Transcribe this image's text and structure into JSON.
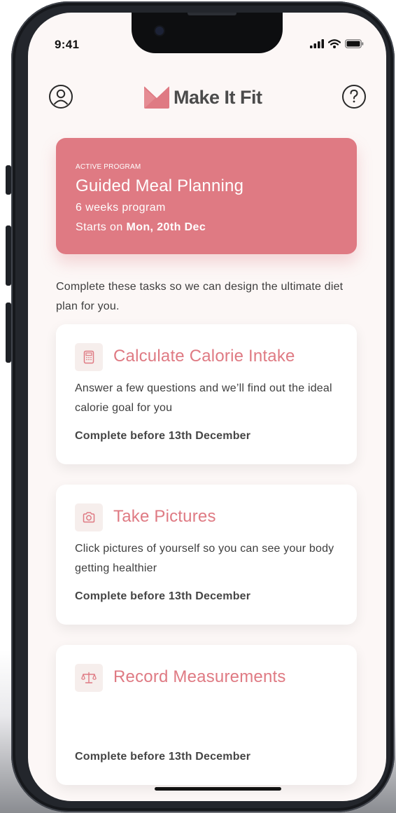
{
  "status_bar": {
    "time": "9:41",
    "icons": [
      "cellular-signal-icon",
      "wifi-icon",
      "battery-icon"
    ]
  },
  "header": {
    "left_icon": "user-profile-icon",
    "app_name": "Make It Fit",
    "logo_icon": "make-it-fit-logo-icon",
    "right_icon": "help-question-icon"
  },
  "active_program": {
    "kicker": "ACTIVE PROGRAM",
    "title": "Guided Meal Planning",
    "duration": "6 weeks program",
    "start_prefix": "Starts on ",
    "start_date": "Mon, 20th Dec"
  },
  "intro_text": "Complete these tasks so we can design the ultimate diet plan for you.",
  "tasks": [
    {
      "icon": "calculator-icon",
      "title": "Calculate Calorie Intake",
      "description": "Answer a few questions and we’ll find out the ideal calorie goal for you",
      "deadline": "Complete before 13th December"
    },
    {
      "icon": "camera-icon",
      "title": "Take Pictures",
      "description": "Click pictures of yourself so you can see your body getting healthier",
      "deadline": "Complete before 13th December"
    },
    {
      "icon": "scale-balance-icon",
      "title": "Record Measurements",
      "description": "",
      "deadline": "Complete before 13th December"
    }
  ],
  "colors": {
    "accent": "#df7a83",
    "screen_background": "#fcf7f6",
    "card_background": "#ffffff",
    "icon_tile": "#f6eeec",
    "text_primary": "#3e3e3e",
    "phone_frame": "#23262c"
  }
}
